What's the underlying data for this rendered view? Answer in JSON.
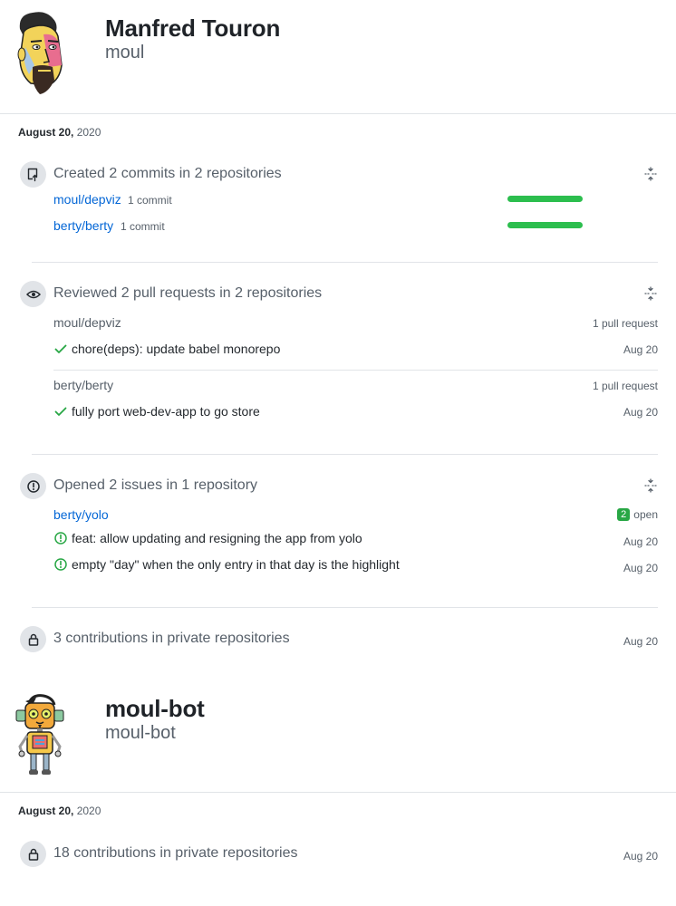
{
  "users": [
    {
      "display_name": "Manfred Touron",
      "login": "moul",
      "date_day": "August 20,",
      "date_year": "2020"
    },
    {
      "display_name": "moul-bot",
      "login": "moul-bot",
      "date_day": "August 20,",
      "date_year": "2020"
    }
  ],
  "commits": {
    "title": "Created 2 commits in 2 repositories",
    "repos": [
      {
        "name": "moul/depviz",
        "count": "1 commit",
        "bar_fraction": 1.0
      },
      {
        "name": "berty/berty",
        "count": "1 commit",
        "bar_fraction": 1.0
      }
    ]
  },
  "reviews": {
    "title": "Reviewed 2 pull requests in 2 repositories",
    "groups": [
      {
        "repo": "moul/depviz",
        "count": "1 pull request",
        "item": "chore(deps): update babel monorepo",
        "date": "Aug 20"
      },
      {
        "repo": "berty/berty",
        "count": "1 pull request",
        "item": "fully port web-dev-app to go store",
        "date": "Aug 20"
      }
    ]
  },
  "issues": {
    "title": "Opened 2 issues in 1 repository",
    "repo": "berty/yolo",
    "open_count": "2",
    "open_label": "open",
    "items": [
      {
        "title": "feat: allow updating and resigning the app from yolo",
        "date": "Aug 20"
      },
      {
        "title": "empty \"day\" when the only entry in that day is the highlight",
        "date": "Aug 20"
      }
    ]
  },
  "private1": {
    "text": "3 contributions in private repositories",
    "date": "Aug 20"
  },
  "private2": {
    "text": "18 contributions in private repositories",
    "date": "Aug 20"
  },
  "colors": {
    "link": "#0366d6",
    "bar": "#2cbe4e",
    "success": "#28a745"
  }
}
